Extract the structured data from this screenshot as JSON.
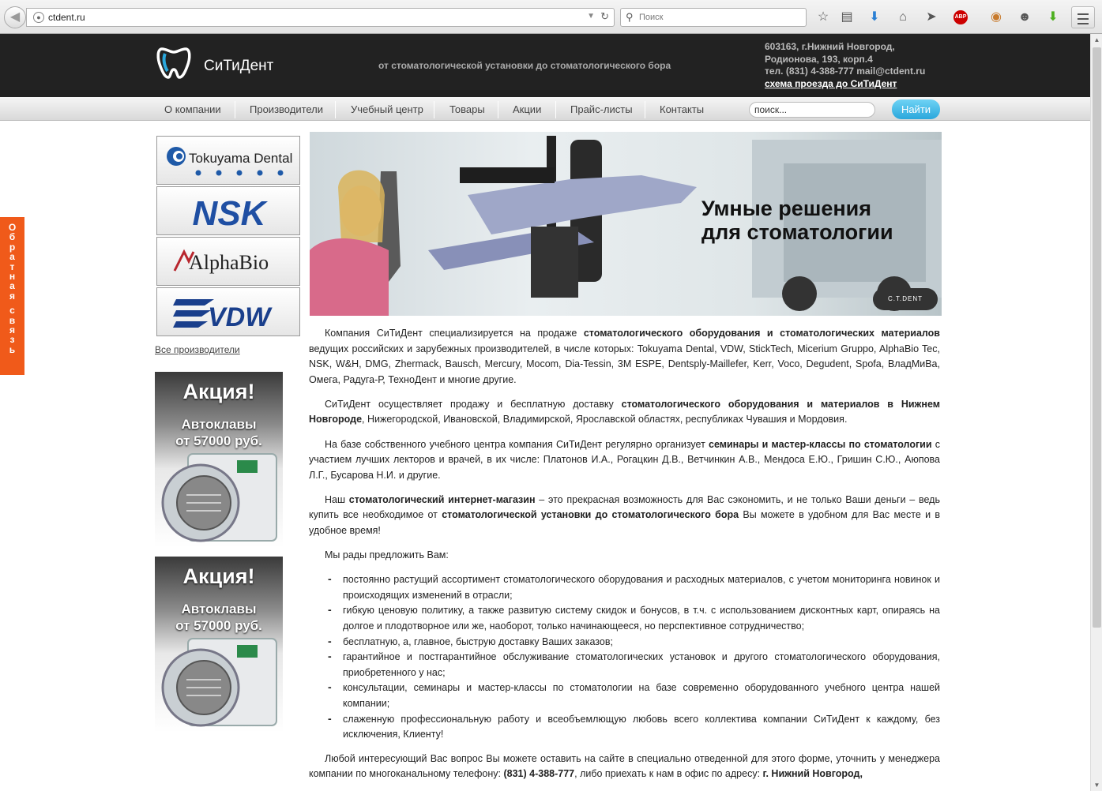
{
  "browser": {
    "url": "ctdent.ru",
    "search_placeholder": "Поиск",
    "abp_label": "ABP"
  },
  "header": {
    "logo_text": "СиТиДент",
    "tagline": "от стоматологической установки до стоматологического бора",
    "address_line1": "603163, г.Нижний Новгород,",
    "address_line2": "Родионова, 193, корп.4",
    "phone_line": "тел. (831) 4-388-777 mail@ctdent.ru",
    "directions_link": "схема проезда до СиТиДент"
  },
  "nav": {
    "items": [
      "О компании",
      "Производители",
      "Учебный центр",
      "Товары",
      "Акции",
      "Прайс-листы",
      "Контакты"
    ],
    "search_value": "поиск...",
    "search_button": "Найти"
  },
  "sidebar": {
    "brands": [
      "Tokuyama Dental",
      "NSK",
      "AlphaBio",
      "VDW"
    ],
    "all_manufacturers": "Все производители",
    "promos": [
      {
        "title": "Акция!",
        "line1": "Автоклавы",
        "line2": "от 57000 руб."
      },
      {
        "title": "Акция!",
        "line1": "Автоклавы",
        "line2": "от 57000 руб."
      }
    ]
  },
  "feedback_tab": "Обратная связь",
  "banner": {
    "heading_line1": "Умные решения",
    "heading_line2": "для стоматологии",
    "badge": "C.T.DENT"
  },
  "content": {
    "p1_a": "Компания СиТиДент специализируется на продаже ",
    "p1_b": "стоматологического оборудования и стоматологических материалов",
    "p1_c": " ведущих российских и зарубежных производителей, в числе которых: Tokuyama Dental, VDW, StickTech, Micerium Gruppo, AlphaBio Tec, NSK, W&H, DMG, Zhermack, Bausch, Mercury, Mocom, Dia-Tessin, 3M ESPE, Dentsply-Maillefer, Kerr, Voco, Degudent, Spofa, ВладМиВа, Омега, Радуга-Р, ТехноДент и многие другие.",
    "p2_a": "СиТиДент осуществляет продажу и бесплатную доставку ",
    "p2_b": "стоматологического оборудования и материалов в Нижнем Новгороде",
    "p2_c": ", Нижегородской, Ивановской, Владимирской, Ярославской областях, республиках Чувашия и Мордовия.",
    "p3_a": "На базе собственного учебного центра компания СиТиДент регулярно организует ",
    "p3_b": "семинары и мастер-классы по стоматологии",
    "p3_c": " с участием лучших лекторов и врачей, в их числе: Платонов И.А., Рогацкин Д.В., Ветчинкин А.В., Мендоса Е.Ю., Гришин С.Ю., Аюпова Л.Г., Бусарова Н.И. и другие.",
    "p4_a": "Наш ",
    "p4_b": "стоматологический интернет-магазин",
    "p4_c": " – это прекрасная возможность для Вас сэкономить, и не только Ваши деньги – ведь купить все необходимое от ",
    "p4_d": "стоматологической установки до стоматологического бора",
    "p4_e": " Вы можете в удобном для Вас месте и в удобное время!",
    "p5": "Мы рады предложить Вам:",
    "list": [
      "постоянно растущий ассортимент стоматологического оборудования и расходных материалов, с учетом мониторинга новинок и происходящих изменений в отрасли;",
      "гибкую ценовую политику, а также развитую систему скидок и бонусов, в т.ч. с использованием дисконтных карт, опираясь на долгое и плодотворное или же, наоборот, только начинающееся, но перспективное сотрудничество;",
      "бесплатную, а, главное, быструю доставку Ваших заказов;",
      "гарантийное и постгарантийное обслуживание стоматологических установок и другого стоматологического оборудования, приобретенного у нас;",
      "консультации, семинары и мастер-классы по стоматологии на базе современно оборудованного учебного центра нашей компании;",
      "слаженную профессиональную работу и всеобъемлющую любовь всего коллектива компании СиТиДент к каждому, без исключения, Клиенту!"
    ],
    "p6_a": "Любой интересующий Вас вопрос Вы можете оставить на сайте в специально отведенной для этого форме, уточнить у менеджера компании по многоканальному телефону: ",
    "p6_b": "(831) 4-388-777",
    "p6_c": ", либо приехать к нам в офис по адресу: ",
    "p6_d": "г. Нижний Новгород,"
  },
  "colors": {
    "header_bg": "#222222",
    "feedback_tab": "#f05a1a",
    "search_button": "#2aa7dc"
  }
}
